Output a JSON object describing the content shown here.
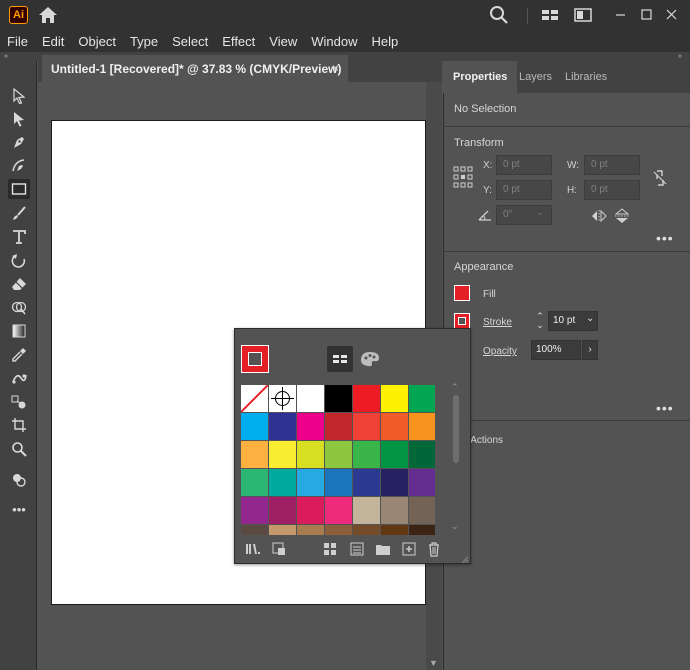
{
  "app": {
    "logo_text": "Ai"
  },
  "menu": {
    "items": [
      "File",
      "Edit",
      "Object",
      "Type",
      "Select",
      "Effect",
      "View",
      "Window",
      "Help"
    ]
  },
  "document_tab": {
    "title": "Untitled-1 [Recovered]* @ 37.83 % (CMYK/Preview)",
    "close": "×"
  },
  "panels": {
    "tabs": [
      "Properties",
      "Layers",
      "Libraries"
    ],
    "active_tab": "Properties",
    "selection_status": "No Selection",
    "transform": {
      "heading": "Transform",
      "x_label": "X:",
      "x_placeholder": "0 pt",
      "y_label": "Y:",
      "y_placeholder": "0 pt",
      "w_label": "W:",
      "w_placeholder": "0 pt",
      "h_label": "H:",
      "h_placeholder": "0 pt",
      "angle_placeholder": "0°"
    },
    "appearance": {
      "heading": "Appearance",
      "fill_label": "Fill",
      "stroke_label": "Stroke",
      "stroke_value": "10 pt",
      "opacity_label": "Opacity",
      "opacity_value": "100%"
    },
    "quick_actions_partial": "k Actions"
  },
  "collapse_glyph": "»",
  "more_glyph": "•••",
  "colors": {
    "fill": "#e51f26",
    "stroke": "#e51f26",
    "accent": "#2f9bd6"
  },
  "swatches": {
    "rows": [
      [
        "none",
        "registration",
        "#ffffff",
        "#000000",
        "#ed1c24",
        "#fff200",
        "#00a651"
      ],
      [
        "#00aeef",
        "#2e3192",
        "#ec008c",
        "#c1272d",
        "#ef4136",
        "#f15a29",
        "#f7941d"
      ],
      [
        "#fbb040",
        "#f9ed32",
        "#d7df23",
        "#8dc63f",
        "#39b54a",
        "#009444",
        "#006838"
      ],
      [
        "#2bb673",
        "#00a99d",
        "#27aae1",
        "#1c75bc",
        "#2b3990",
        "#262262",
        "#662d91"
      ],
      [
        "#92278f",
        "#9e1f63",
        "#da1c5c",
        "#ee2a7b",
        "#c2b59b",
        "#998675",
        "#736357"
      ],
      [
        "#594a42",
        "#c49a6c",
        "#a97c50",
        "#8b5e3c",
        "#754c29",
        "#603913",
        "#3c2415"
      ]
    ]
  }
}
